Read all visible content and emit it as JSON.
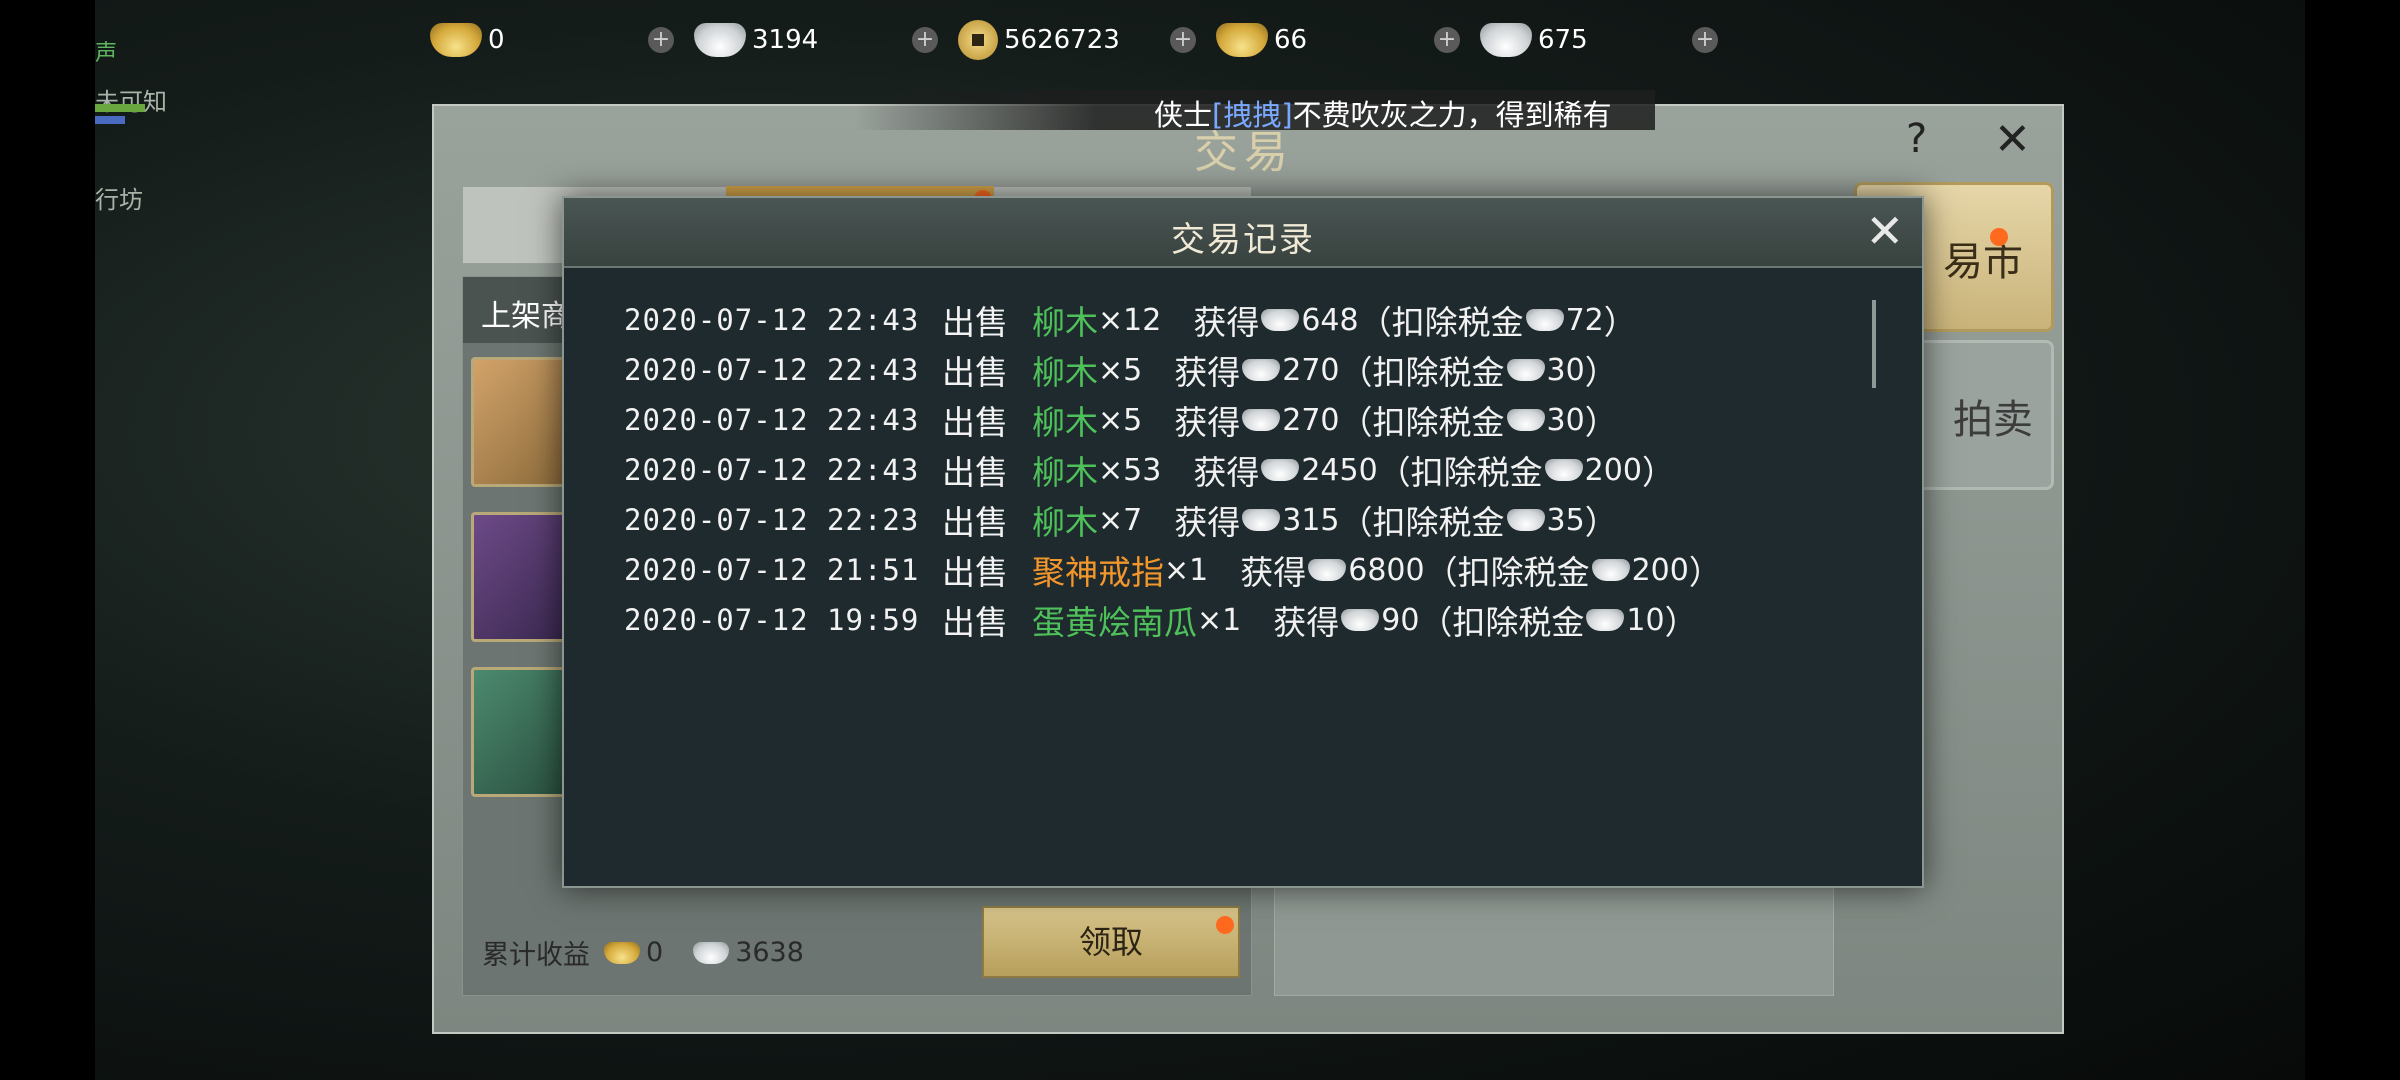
{
  "colors": {
    "item_green": "#4fc15a",
    "item_orange": "#f3962b",
    "item_blue": "#3fa2ff",
    "link_blue": "#7aa8ff"
  },
  "scene": {
    "left_text_1": "未可知",
    "left_text_2": "行坊",
    "left_text_0": "声"
  },
  "currency": {
    "gold_ingot": "0",
    "silver_ingot": "3194",
    "copper_coin": "5626723",
    "gold_bound": "66",
    "silver_bound": "675",
    "plus_symbol": "+"
  },
  "broadcast": {
    "prefix": "侠士",
    "link": "[拽拽]",
    "suffix": "不费吹灰之力，得到稀有"
  },
  "trade_window": {
    "title": "交易",
    "help": "?",
    "close": "✕",
    "listing_header": "上架商",
    "income_label": "累计收益",
    "income_gold": "0",
    "income_silver": "3638",
    "claim_button": "领取",
    "side_tab_market": "易市",
    "side_tab_auction": "拍卖"
  },
  "dialog": {
    "title": "交易记录",
    "close": "✕",
    "records": [
      {
        "time": "2020-07-12 22:43",
        "action": "出售",
        "item": "柳木",
        "color": "green",
        "qty": "×12",
        "gain_label": "获得",
        "amount": "648",
        "tax_prefix": "（扣除税金",
        "tax": "72",
        "tax_suffix": "）"
      },
      {
        "time": "2020-07-12 22:43",
        "action": "出售",
        "item": "柳木",
        "color": "green",
        "qty": "×5",
        "gain_label": "获得",
        "amount": "270",
        "tax_prefix": "（扣除税金",
        "tax": "30",
        "tax_suffix": "）"
      },
      {
        "time": "2020-07-12 22:43",
        "action": "出售",
        "item": "柳木",
        "color": "green",
        "qty": "×5",
        "gain_label": "获得",
        "amount": "270",
        "tax_prefix": "（扣除税金",
        "tax": "30",
        "tax_suffix": "）"
      },
      {
        "time": "2020-07-12 22:43",
        "action": "出售",
        "item": "柳木",
        "color": "green",
        "qty": "×53",
        "gain_label": "获得",
        "amount": "2450",
        "tax_prefix": "（扣除税金",
        "tax": "200",
        "tax_suffix": "）"
      },
      {
        "time": "2020-07-12 22:23",
        "action": "出售",
        "item": "柳木",
        "color": "green",
        "qty": "×7",
        "gain_label": "获得",
        "amount": "315",
        "tax_prefix": "（扣除税金",
        "tax": "35",
        "tax_suffix": "）"
      },
      {
        "time": "2020-07-12 21:51",
        "action": "出售",
        "item": "聚神戒指",
        "color": "orange",
        "qty": "×1",
        "gain_label": "获得",
        "amount": "6800",
        "tax_prefix": "（扣除税金",
        "tax": "200",
        "tax_suffix": "）"
      },
      {
        "time": "2020-07-12 19:59",
        "action": "出售",
        "item": "蛋黄烩南瓜",
        "color": "green",
        "qty": "×1",
        "gain_label": "获得",
        "amount": "90",
        "tax_prefix": "（扣除税金",
        "tax": "10",
        "tax_suffix": "）"
      }
    ]
  }
}
